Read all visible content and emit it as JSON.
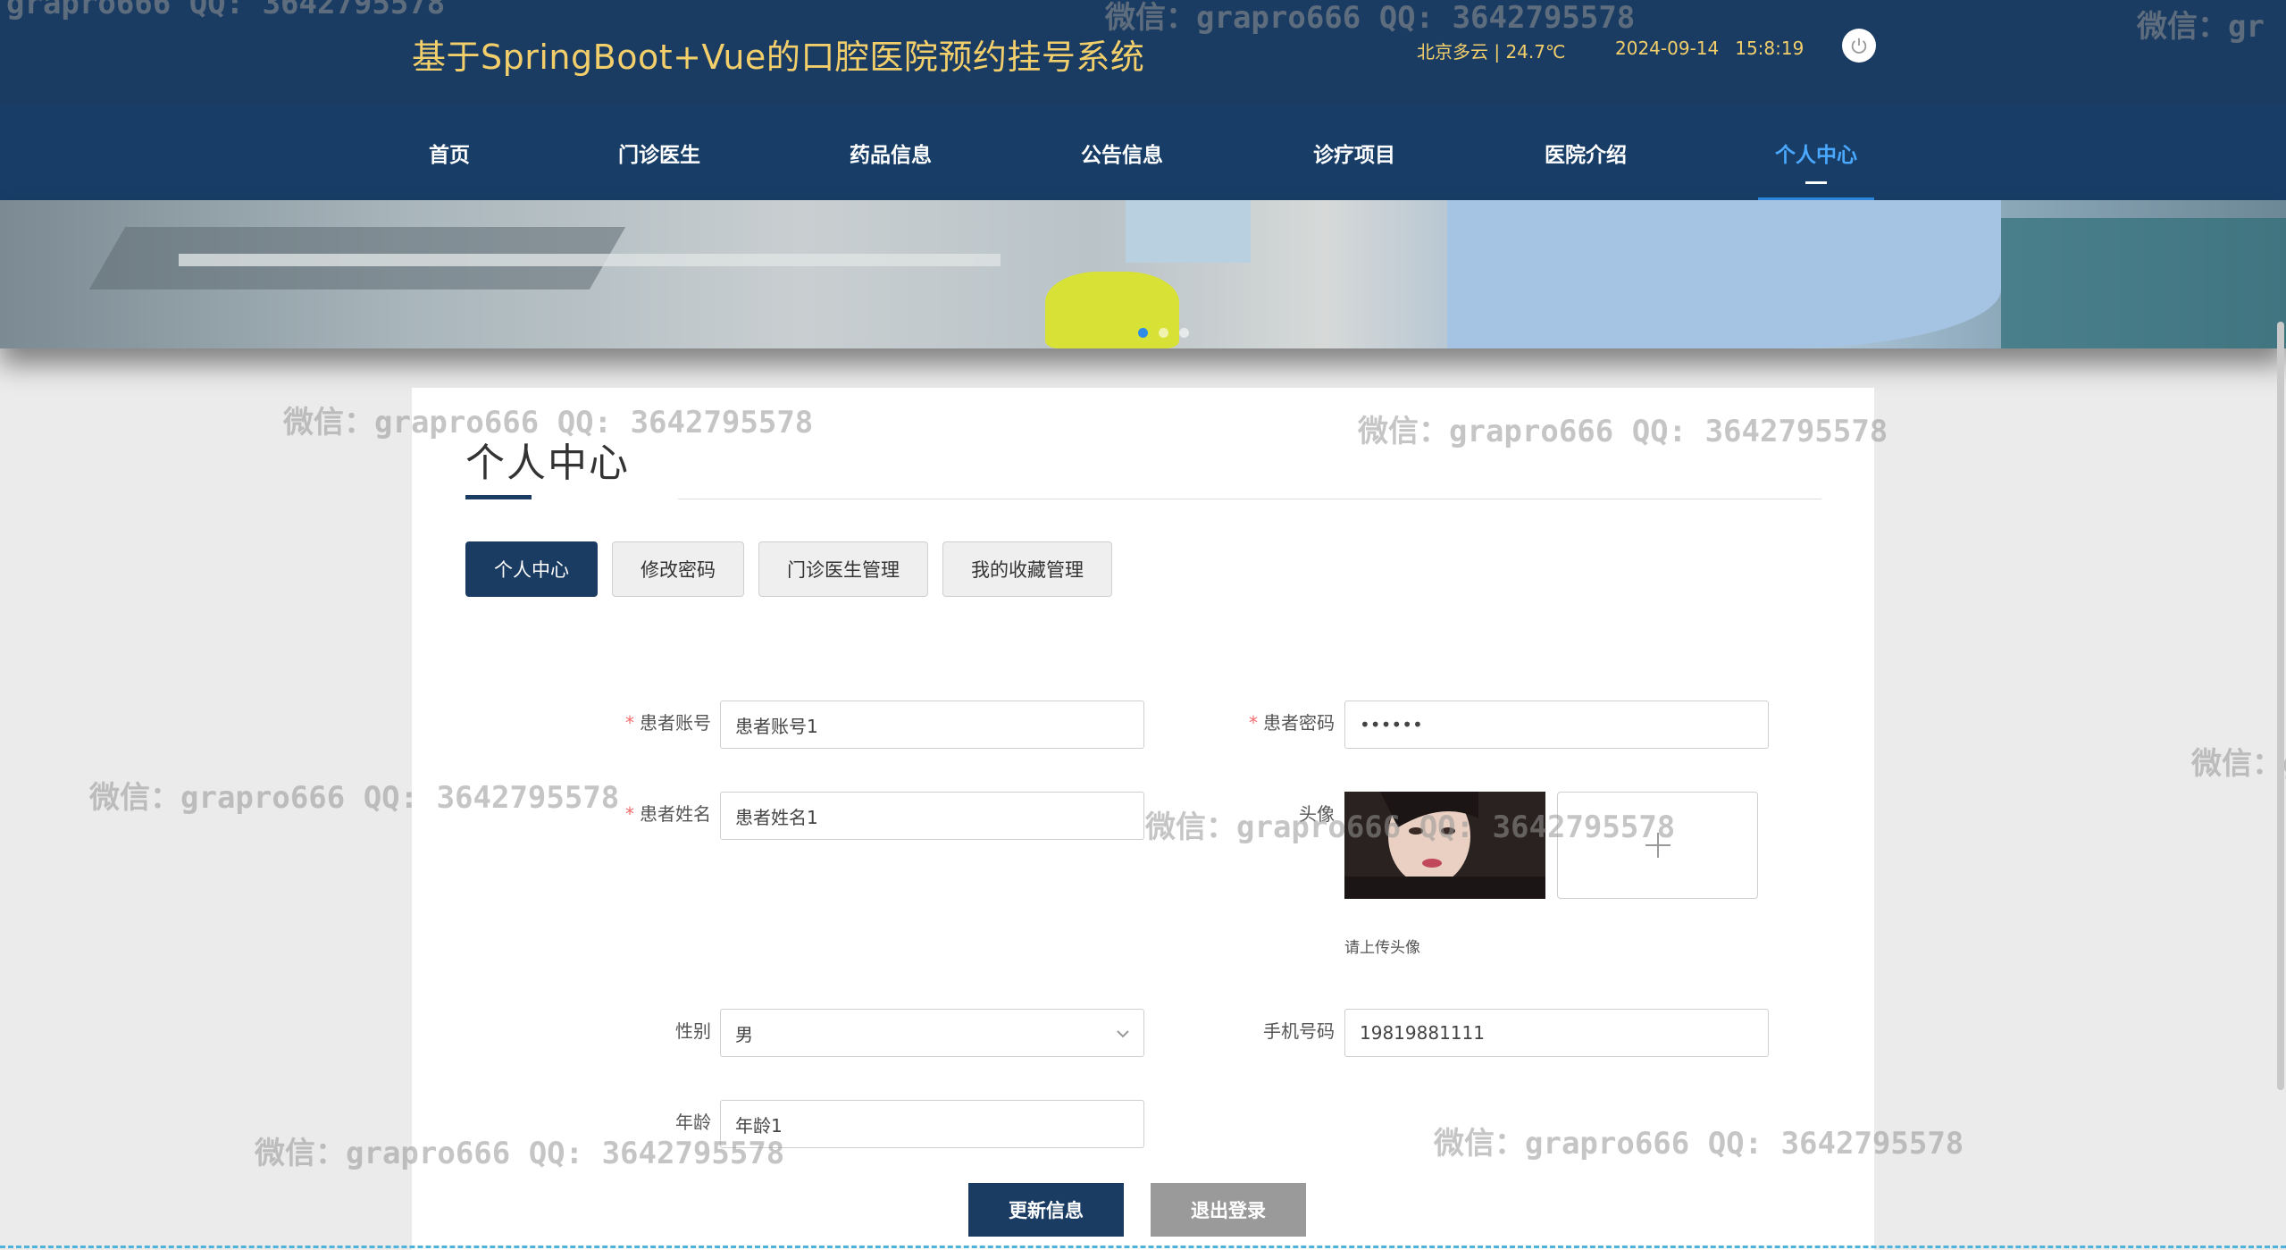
{
  "header": {
    "site_title": "基于SpringBoot+Vue的口腔医院预约挂号系统",
    "weather": "北京多云 | 24.7℃",
    "date": "2024-09-14",
    "time": "15:8:19",
    "power_icon": "power-icon"
  },
  "nav": {
    "items": [
      {
        "label": "首页"
      },
      {
        "label": "门诊医生"
      },
      {
        "label": "药品信息"
      },
      {
        "label": "公告信息"
      },
      {
        "label": "诊疗项目"
      },
      {
        "label": "医院介绍"
      },
      {
        "label": "个人中心"
      }
    ],
    "active_index": 6
  },
  "banner": {
    "dots_count": 3,
    "active_dot": 0
  },
  "page": {
    "title": "个人中心",
    "tabs": [
      {
        "label": "个人中心"
      },
      {
        "label": "修改密码"
      },
      {
        "label": "门诊医生管理"
      },
      {
        "label": "我的收藏管理"
      }
    ],
    "active_tab": 0
  },
  "form": {
    "account_label": "患者账号",
    "account_value": "患者账号1",
    "password_label": "患者密码",
    "password_value": "••••••",
    "name_label": "患者姓名",
    "name_value": "患者姓名1",
    "avatar_label": "头像",
    "avatar_hint": "请上传头像",
    "gender_label": "性别",
    "gender_value": "男",
    "phone_label": "手机号码",
    "phone_value": "19819881111",
    "age_label": "年龄",
    "age_value": "年龄1",
    "required_mark": "*"
  },
  "buttons": {
    "update": "更新信息",
    "logout": "退出登录"
  },
  "watermark": {
    "text": "微信：grapro666 QQ: 3642795578",
    "partial_right": "微信：gr",
    "partial_left": "微信：grapro666 QQ: 3642795578"
  },
  "colors": {
    "header_bg": "#1b3c62",
    "title_gold": "#f3cf6b",
    "nav_active": "#4aa8ff",
    "primary_button": "#1b3c62",
    "secondary_button": "#9a9a9a",
    "required": "#f56c6c"
  }
}
